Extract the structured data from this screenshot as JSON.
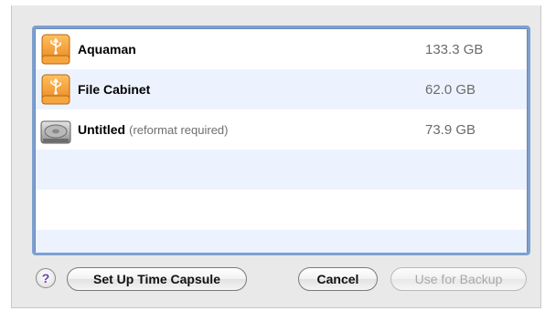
{
  "disks": [
    {
      "name": "Aquaman",
      "note": "",
      "size": "133.3 GB",
      "icon": "usb-drive-icon"
    },
    {
      "name": "File Cabinet",
      "note": "",
      "size": "62.0 GB",
      "icon": "usb-drive-icon"
    },
    {
      "name": "Untitled",
      "note": "(reformat required)",
      "size": "73.9 GB",
      "icon": "internal-disk-icon"
    }
  ],
  "buttons": {
    "help": "?",
    "setup": "Set Up Time Capsule",
    "cancel": "Cancel",
    "use_for_backup": "Use for Backup"
  },
  "colors": {
    "list_focus_ring": "#7da0d0",
    "row_alt": "#edf3fe",
    "size_text": "#6b6b6b",
    "drive_orange": "#f09a2a"
  }
}
